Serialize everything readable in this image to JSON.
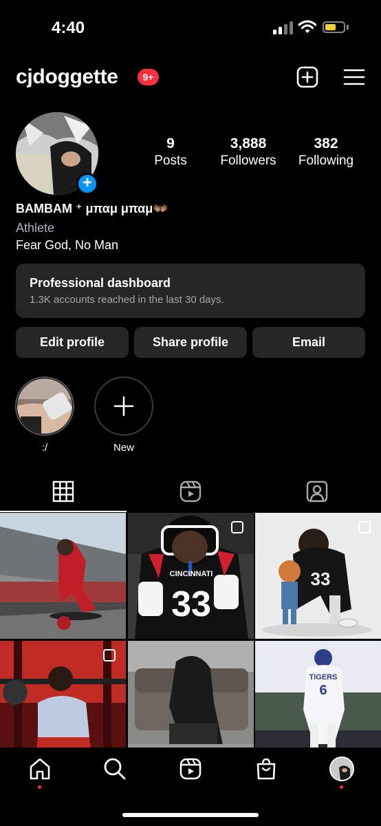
{
  "status_bar": {
    "time": "4:40",
    "battery_level": 0.45
  },
  "header": {
    "username": "cjdoggette",
    "notification_badge": "9+"
  },
  "profile": {
    "stats": [
      {
        "value": "9",
        "label": "Posts"
      },
      {
        "value": "3,888",
        "label": "Followers"
      },
      {
        "value": "382",
        "label": "Following"
      }
    ],
    "display_name": "BAMBAM ⁺ μπαμ μπαμ👐🏽",
    "category": "Athlete",
    "bio": "Fear God, No Man"
  },
  "dashboard": {
    "title": "Professional dashboard",
    "subtitle": "1.3K accounts reached in the last 30 days."
  },
  "buttons": {
    "edit": "Edit profile",
    "share": "Share profile",
    "email": "Email"
  },
  "highlights": [
    {
      "label": ":/"
    },
    {
      "label": "New"
    }
  ],
  "tabs": [
    "grid-icon",
    "reels-icon",
    "tagged-icon"
  ],
  "grid_numbers": {
    "post2_jersey": "33",
    "post3_jersey": "33",
    "post6_jersey": "6",
    "post2_text": "CINCINNATI",
    "post6_text": "TIGERS"
  },
  "colors": {
    "accent_blue": "#0095f6",
    "notification_red": "#ff3040",
    "surface": "#262626"
  }
}
